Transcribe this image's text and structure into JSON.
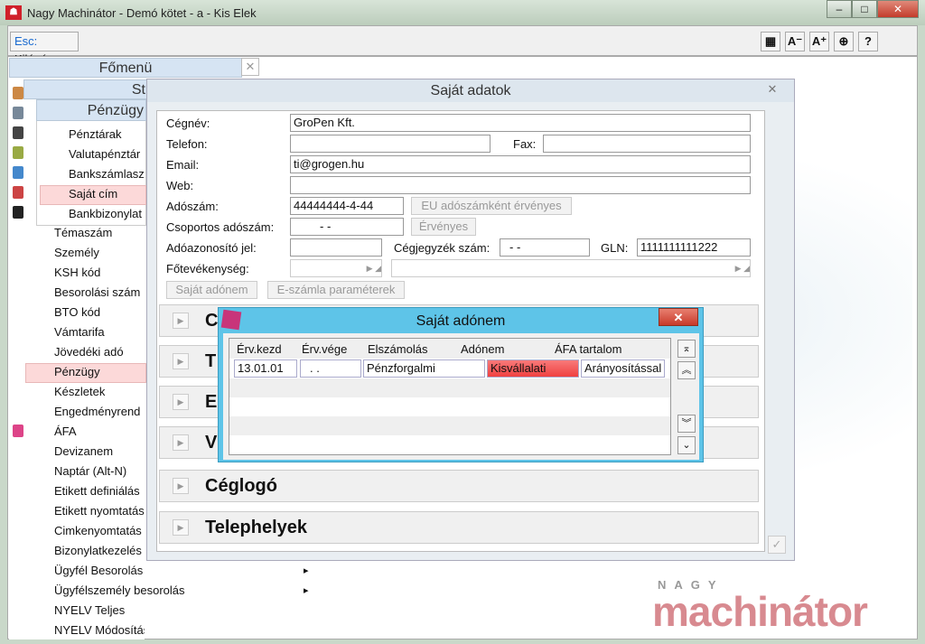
{
  "window": {
    "title": "Nagy Machinátor - Demó kötet - a - Kis Elek",
    "icon": "app-logo-icon",
    "minimize": "–",
    "maximize": "□",
    "close": "✕"
  },
  "toolbar": {
    "esc_key": "Esc:",
    "esc_label": "Kilépés",
    "buttons": [
      {
        "icon": "grid-icon",
        "glyph": "▦"
      },
      {
        "icon": "font-smaller-icon",
        "glyph": "A⁻"
      },
      {
        "icon": "font-larger-icon",
        "glyph": "A⁺"
      },
      {
        "icon": "lifebuoy-icon",
        "glyph": "⊕"
      },
      {
        "icon": "help-icon",
        "glyph": "?"
      }
    ]
  },
  "main_menu": {
    "title": "Főmenü",
    "close": "✕",
    "items": [
      {
        "label": "Témaszám"
      },
      {
        "label": "Személy"
      },
      {
        "label": "KSH kód"
      },
      {
        "label": "Besorolási szám"
      },
      {
        "label": "BTO kód"
      },
      {
        "label": "Vámtarifa"
      },
      {
        "label": "Jövedéki adó"
      },
      {
        "label": "Pénzügy",
        "selected": true
      },
      {
        "label": "Készletek"
      },
      {
        "label": "Engedményrend"
      },
      {
        "label": "ÁFA"
      },
      {
        "label": "Devizanem"
      },
      {
        "label": "Naptár (Alt-N)"
      },
      {
        "label": "Etikett definiálás"
      },
      {
        "label": "Etikett nyomtatás"
      },
      {
        "label": "Cimkenyomtatás"
      },
      {
        "label": "Bizonylatkezelés"
      },
      {
        "label": "Ügyfél Besorolás",
        "submenu": true
      },
      {
        "label": "Ügyfélszemély besorolás",
        "submenu": true
      },
      {
        "label": "NYELV Teljes"
      },
      {
        "label": "NYELV Módosítás"
      }
    ]
  },
  "st_panel": {
    "title": "St"
  },
  "penzugy_menu": {
    "title": "Pénzügy",
    "items": [
      {
        "label": "Pénztárak"
      },
      {
        "label": "Valutapénztár"
      },
      {
        "label": "Bankszámlasz"
      },
      {
        "label": "Saját cím",
        "selected": true
      },
      {
        "label": "Bankbizonylat"
      }
    ]
  },
  "dialog": {
    "title": "Saját adatok",
    "close": "✕",
    "labels": {
      "cegnev": "Cégnév:",
      "telefon": "Telefon:",
      "fax": "Fax:",
      "email": "Email:",
      "web": "Web:",
      "adoszam": "Adószám:",
      "csoport": "Csoportos adószám:",
      "adoazon": "Adóazonosító jel:",
      "cegjegyzek": "Cégjegyzék szám:",
      "gln": "GLN:",
      "fotev": "Főtevékenység:"
    },
    "values": {
      "cegnev": "GroPen Kft.",
      "telefon": "",
      "fax": "",
      "email": "ti@grogen.hu",
      "web": "",
      "adoszam": "44444444-4-44",
      "csoport": "- -",
      "adoazon": "",
      "cegjegyzek": "-  -",
      "gln": "1111111111222",
      "fotev": ""
    },
    "buttons": {
      "eu": "EU adószámként érvényes",
      "ervenyes": "Érvényes",
      "sajat_adonem": "Saját adónem",
      "eszamla": "E-számla paraméterek"
    },
    "sections": [
      "C",
      "T",
      "E",
      "V",
      "Céglogó",
      "Telephelyek"
    ],
    "ok": "✓"
  },
  "subdialog": {
    "title": "Saját adónem",
    "close": "✕",
    "columns": [
      "Érv.kezd",
      "Érv.vége",
      "Elszámolás",
      "Adónem",
      "ÁFA tartalom"
    ],
    "rows": [
      [
        "13.01.01",
        " .  .",
        "Pénzforgalmi",
        "Kisvállalati",
        "Arányosítással"
      ]
    ],
    "nav": [
      "⌅",
      "︽",
      "︾",
      "⌄"
    ]
  },
  "logo": {
    "top": "NAGY",
    "main": "machinátor"
  }
}
